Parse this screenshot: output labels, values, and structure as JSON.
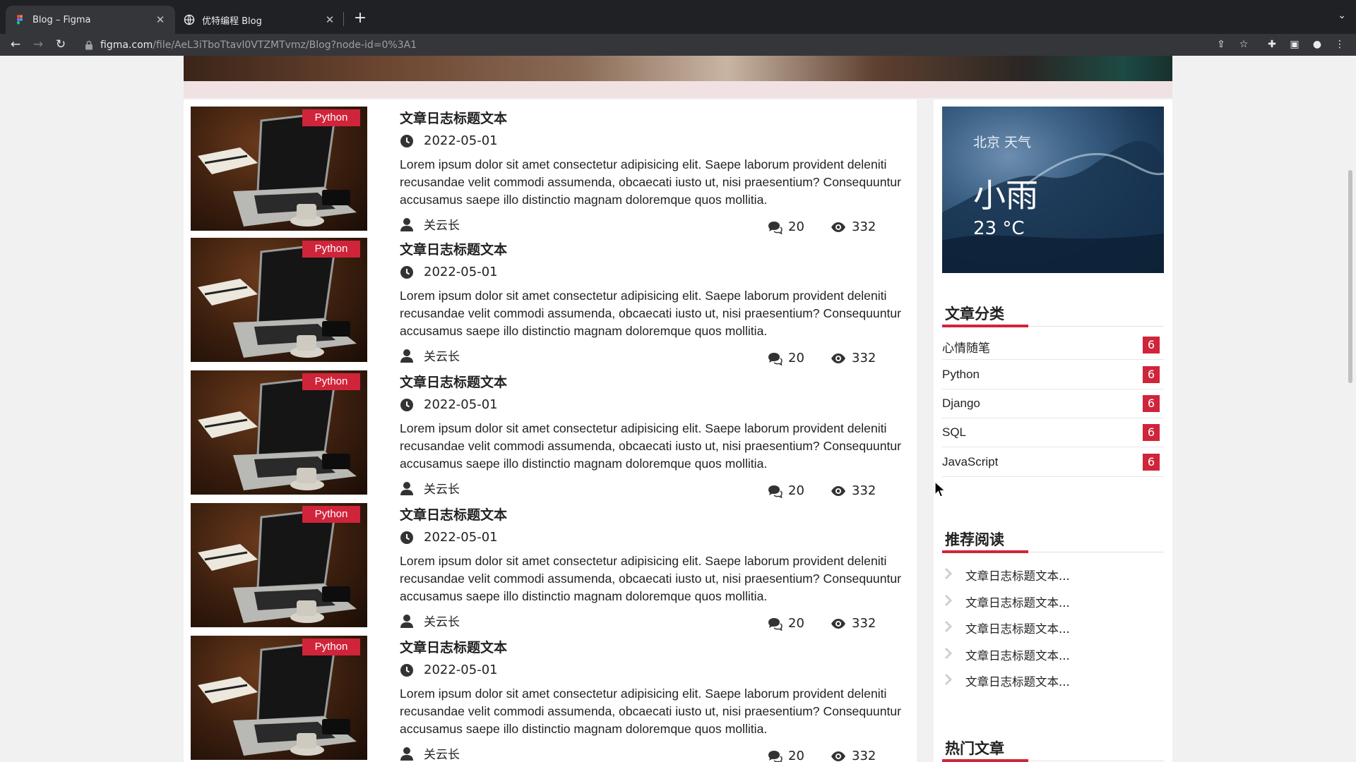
{
  "browser": {
    "tabs": [
      {
        "title": "Blog – Figma",
        "active": true
      },
      {
        "title": "优特编程 Blog",
        "active": false
      }
    ],
    "url_host": "figma.com",
    "url_path": "/file/AeL3iTboTtavl0VTZMTvmz/Blog?node-id=0%3A1"
  },
  "posts": [
    {
      "tag": "Python",
      "title": "文章日志标题文本",
      "date": "2022-05-01",
      "body": "Lorem ipsum dolor sit amet consectetur adipisicing elit. Saepe laborum provident deleniti recusandae velit commodi assumenda, obcaecati iusto ut, nisi praesentium? Consequuntur accusamus saepe illo distinctio magnam doloremque quos mollitia.",
      "author": "关云长",
      "comments": "20",
      "views": "332"
    },
    {
      "tag": "Python",
      "title": "文章日志标题文本",
      "date": "2022-05-01",
      "body": "Lorem ipsum dolor sit amet consectetur adipisicing elit. Saepe laborum provident deleniti recusandae velit commodi assumenda, obcaecati iusto ut, nisi praesentium? Consequuntur accusamus saepe illo distinctio magnam doloremque quos mollitia.",
      "author": "关云长",
      "comments": "20",
      "views": "332"
    },
    {
      "tag": "Python",
      "title": "文章日志标题文本",
      "date": "2022-05-01",
      "body": "Lorem ipsum dolor sit amet consectetur adipisicing elit. Saepe laborum provident deleniti recusandae velit commodi assumenda, obcaecati iusto ut, nisi praesentium? Consequuntur accusamus saepe illo distinctio magnam doloremque quos mollitia.",
      "author": "关云长",
      "comments": "20",
      "views": "332"
    },
    {
      "tag": "Python",
      "title": "文章日志标题文本",
      "date": "2022-05-01",
      "body": "Lorem ipsum dolor sit amet consectetur adipisicing elit. Saepe laborum provident deleniti recusandae velit commodi assumenda, obcaecati iusto ut, nisi praesentium? Consequuntur accusamus saepe illo distinctio magnam doloremque quos mollitia.",
      "author": "关云长",
      "comments": "20",
      "views": "332"
    },
    {
      "tag": "Python",
      "title": "文章日志标题文本",
      "date": "2022-05-01",
      "body": "Lorem ipsum dolor sit amet consectetur adipisicing elit. Saepe laborum provident deleniti recusandae velit commodi assumenda, obcaecati iusto ut, nisi praesentium? Consequuntur accusamus saepe illo distinctio magnam doloremque quos mollitia.",
      "author": "关云长",
      "comments": "20",
      "views": "332"
    }
  ],
  "weather": {
    "city": "北京 天气",
    "condition": "小雨",
    "temperature": "23 °C"
  },
  "categories": {
    "title": "文章分类",
    "items": [
      {
        "name": "心情随笔",
        "count": "6"
      },
      {
        "name": "Python",
        "count": "6"
      },
      {
        "name": "Django",
        "count": "6"
      },
      {
        "name": "SQL",
        "count": "6"
      },
      {
        "name": "JavaScript",
        "count": "6"
      }
    ]
  },
  "recommended": {
    "title": "推荐阅读",
    "items": [
      "文章日志标题文本...",
      "文章日志标题文本...",
      "文章日志标题文本...",
      "文章日志标题文本...",
      "文章日志标题文本..."
    ]
  },
  "hot": {
    "title": "热门文章"
  },
  "colors": {
    "accent": "#d0243a",
    "chrome_dark": "#202124",
    "chrome_toolbar": "#35363a"
  }
}
